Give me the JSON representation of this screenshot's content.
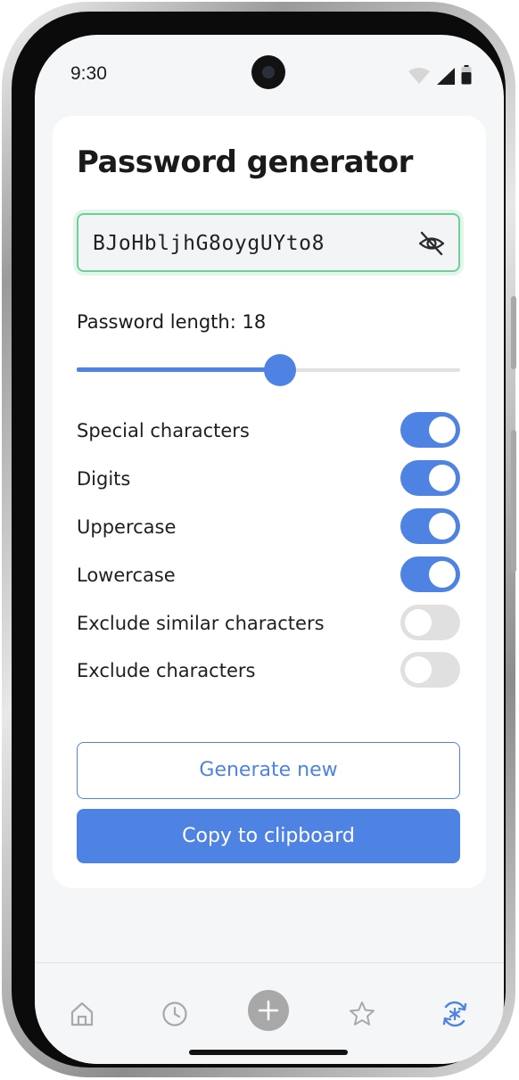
{
  "status_bar": {
    "time": "9:30"
  },
  "generator": {
    "title": "Password generator",
    "password": "BJoHbljhG8oygUYto8",
    "visibility_icon": "eye-off-icon",
    "length_label": "Password length: 18",
    "length_value": 18,
    "length_slider_fraction": 0.53,
    "options": [
      {
        "label": "Special characters",
        "enabled": true
      },
      {
        "label": "Digits",
        "enabled": true
      },
      {
        "label": "Uppercase",
        "enabled": true
      },
      {
        "label": "Lowercase",
        "enabled": true
      },
      {
        "label": "Exclude similar characters",
        "enabled": false
      },
      {
        "label": "Exclude characters",
        "enabled": false
      }
    ],
    "generate_label": "Generate new",
    "copy_label": "Copy to clipboard"
  },
  "bottom_nav": {
    "items": [
      {
        "icon": "home-icon",
        "active": false
      },
      {
        "icon": "clock-icon",
        "active": false
      },
      {
        "icon": "add-icon",
        "active": false
      },
      {
        "icon": "star-icon",
        "active": false
      },
      {
        "icon": "password-generator-icon",
        "active": true
      }
    ]
  },
  "colors": {
    "accent": "#4f83e3",
    "success_border": "#6fcf97",
    "toggle_off": "#e0e0e0"
  }
}
